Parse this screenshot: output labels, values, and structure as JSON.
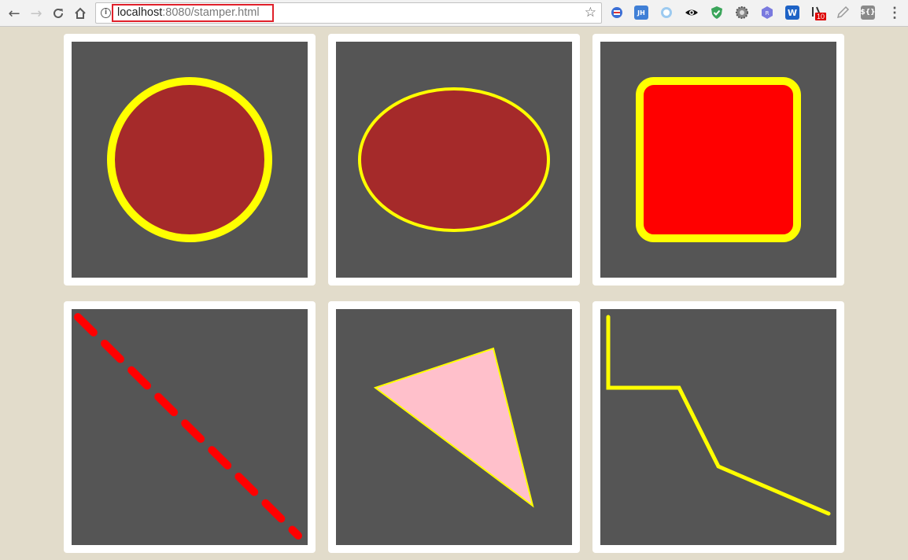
{
  "browser": {
    "url_host": "localhost",
    "url_rest": ":8080/stamper.html",
    "extension_badge": "10"
  },
  "colors": {
    "page_background": "#e2dccb",
    "canvas_background": "#555555",
    "card_background": "#ffffff",
    "stroke_yellow": "#ffff00",
    "fill_brown": "#a52a2a",
    "fill_red": "#ff0000",
    "fill_pink": "#ffc0cb"
  },
  "shapes": [
    {
      "kind": "circle",
      "fill": "#a52a2a",
      "stroke": "#ffff00"
    },
    {
      "kind": "ellipse",
      "fill": "#a52a2a",
      "stroke": "#ffff00"
    },
    {
      "kind": "rounded-rectangle",
      "fill": "#ff0000",
      "stroke": "#ffff00"
    },
    {
      "kind": "dashed-line",
      "stroke": "#ff0000"
    },
    {
      "kind": "triangle",
      "fill": "#ffc0cb",
      "stroke": "#ffff00"
    },
    {
      "kind": "polyline",
      "stroke": "#ffff00"
    }
  ]
}
